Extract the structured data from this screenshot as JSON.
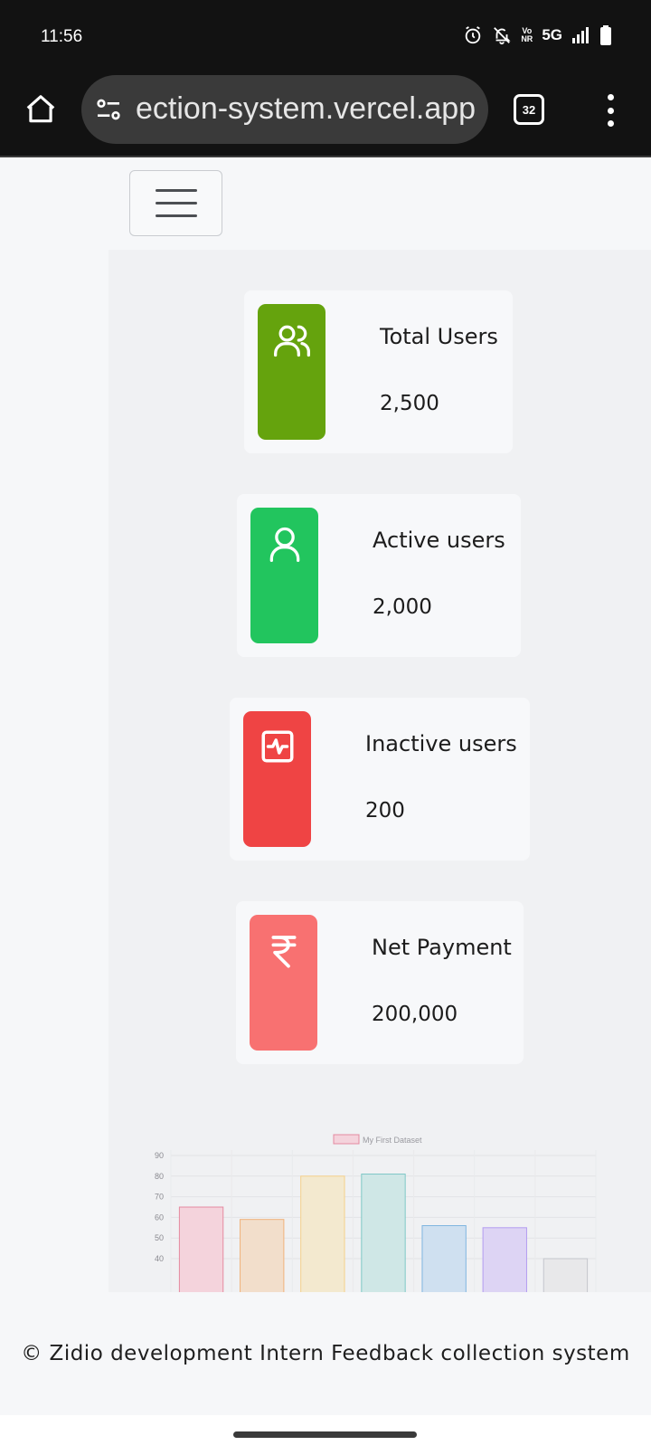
{
  "status_bar": {
    "time": "11:56",
    "network": "5G",
    "volte_top": "Vo",
    "volte_bottom": "NR"
  },
  "browser": {
    "url": "ection-system.vercel.app",
    "tab_count": "32"
  },
  "cards": [
    {
      "label": "Total Users",
      "value": "2,500",
      "icon": "users-icon",
      "color": "#65a30d"
    },
    {
      "label": "Active users",
      "value": "2,000",
      "icon": "user-icon",
      "color": "#22c55e"
    },
    {
      "label": "Inactive users",
      "value": "200",
      "icon": "activity-icon",
      "color": "#ef4444"
    },
    {
      "label": "Net Payment",
      "value": "200,000",
      "icon": "rupee-icon",
      "color": "#f87171"
    }
  ],
  "chart_data": {
    "type": "bar",
    "legend": "My First Dataset",
    "legend_position": "top",
    "grid": true,
    "y_ticks": [
      90,
      80,
      70,
      60,
      50,
      40
    ],
    "ylim": [
      40,
      90
    ],
    "values": [
      65,
      59,
      80,
      81,
      56,
      55,
      40
    ],
    "fill_colors": [
      "#f4d3dc",
      "#f2decb",
      "#f3e9cf",
      "#cfe7e6",
      "#cfe0f0",
      "#ddd4f4",
      "#e8e8ea"
    ],
    "border_colors": [
      "#e48aa0",
      "#f0b27a",
      "#f5d08a",
      "#7fc8c6",
      "#7fb5e0",
      "#b39cf0",
      "#c4c6cc"
    ]
  },
  "footer": {
    "text": "© Zidio development Intern Feedback collection system"
  }
}
